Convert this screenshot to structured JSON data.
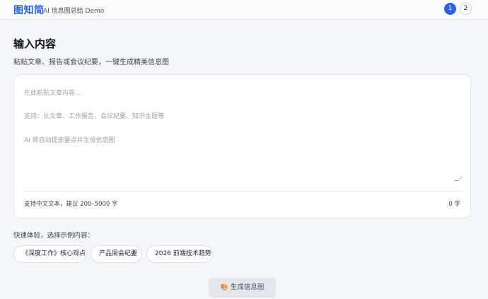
{
  "header": {
    "logo": "图知简",
    "tagline": "AI 信息图总结 Demo",
    "steps": [
      "1",
      "2"
    ],
    "active_step": 1
  },
  "main": {
    "title": "输入内容",
    "subtitle": "粘贴文章、报告或会议纪要，一键生成精美信息图",
    "textarea": {
      "placeholder_lines": [
        "在此粘贴文章内容...",
        "支持：长文章、工作报告、会议纪要、知识主题等",
        "AI 将自动提炼要点并生成信息图"
      ],
      "value": "",
      "hint": "支持中文文本，建议 200–5000 字",
      "char_count": "0 字"
    },
    "quick": {
      "label": "快速体验，选择示例内容：",
      "examples": [
        "《深度工作》核心观点",
        "产品周会纪要",
        "2026 前端技术趋势"
      ]
    },
    "generate_button": {
      "icon": "paint-palette-icon",
      "label": "生成信息图"
    }
  },
  "colors": {
    "accent": "#2b63e0",
    "background": "#f5f6f8",
    "button_disabled": "#e4e7eb"
  }
}
